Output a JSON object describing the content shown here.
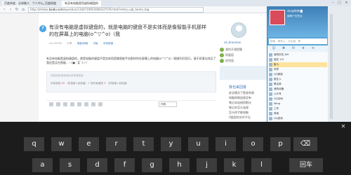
{
  "browser": {
    "tabs": [
      "百度知道 - 全球最大中文互动问答平台",
      "个人中心_百度知道",
      "有没有电脑是用虚拟键盘的"
    ],
    "url_prefix": "http://zhidao.",
    "url_domain": "baidu.com",
    "url_suffix": "/question/1164719655669237576.html?entry=qb_home_tag"
  },
  "question": {
    "title": "有没有电脑是虚拟键盘的，就是电脑的键盘不是实体而是像智能手机那样的在屏幕上的电脑(o^▽^o)（我",
    "meta": [
      "a1134763",
      "分享",
      "电脑/网络",
      "平板",
      "手机制造"
    ],
    "body": "有没有电脑是虚拟键盘的，就是电脑的键盘不是实体而是像智能手机那样的在屏幕上的电脑(o^▽^o)（随便问问而已，毫不愿意出钱买了我还是买台智能…ヽ(●-`Д´-)ノ）",
    "answer_placeholder": "您的回答被采纳后将获得奖励",
    "reward_prefix": "系统奖励",
    "reward_value": "20",
    "reward_mid": "（财富值+经验值）+ 提问者悬赏",
    "reward_value2": "5",
    "reward_suffix": "（财富值+经验值）",
    "code_option": "代码"
  },
  "sidebar": {
    "user_name": "sd_broomon",
    "rows": [
      "我的开通提醒",
      "财富值",
      "经验值"
    ],
    "recommend_title": "我也来回答",
    "recommend_items": [
      "安全模式下登录系统",
      "电脑网络连接没有",
      "笔记本连接投影仪",
      "笔记本怎么连接",
      "怎么样才能电脑",
      "U盘里的文件不见",
      "CPU风扇的作用",
      "电脑系统怎么重装"
    ]
  },
  "qq": {
    "name": "sbvg的神 ▇",
    "signature": "编辑个性签名",
    "search_placeholder": "搜索：联系人、讨论组、群",
    "friends": [
      "我的好友 8/9",
      "朋友 1/3",
      "家人",
      "同学",
      "QQ家族",
      "陌生人",
      "黑名单",
      "我的设备",
      "公众号",
      "QQ空间",
      "Wing",
      "工作",
      "其他",
      "QQ游戏"
    ]
  },
  "keyboard": {
    "row1": [
      "q",
      "w",
      "e",
      "r",
      "t",
      "y",
      "u",
      "i",
      "o",
      "p",
      "⌫"
    ],
    "row2": [
      "a",
      "s",
      "d",
      "f",
      "g",
      "h",
      "j",
      "k",
      "l",
      "回车"
    ]
  },
  "colors": {
    "qq_blue": "#5aa6d9",
    "link": "#3b73b9",
    "keyboard_bg": "#1c1c1c",
    "key_bg": "#3c3c3c"
  }
}
